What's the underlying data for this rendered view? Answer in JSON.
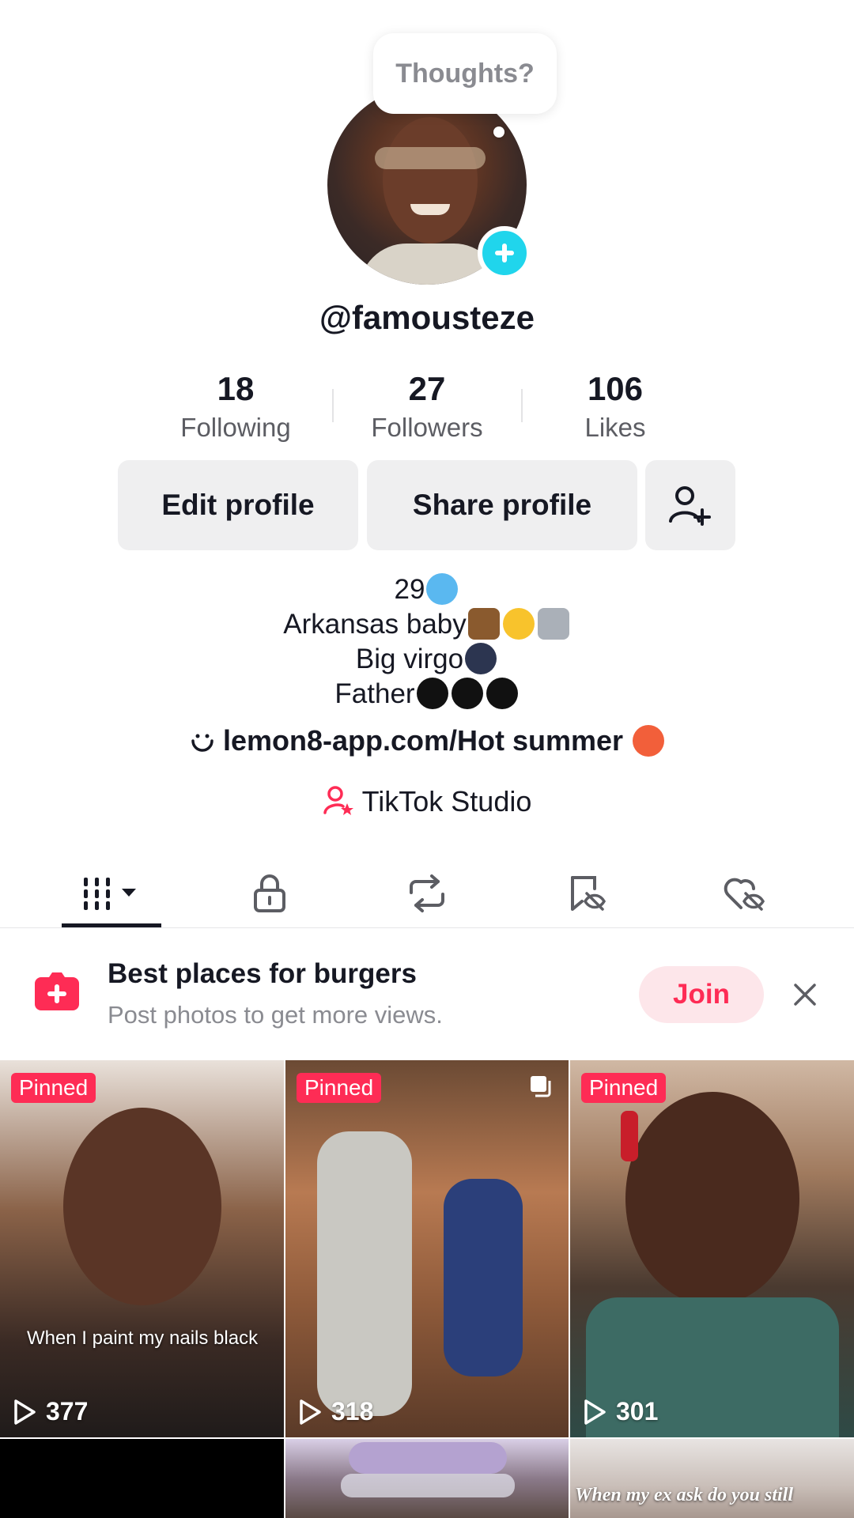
{
  "profile": {
    "bubble_text": "Thoughts?",
    "username": "@famousteze"
  },
  "stats": [
    {
      "value": "18",
      "label": "Following"
    },
    {
      "value": "27",
      "label": "Followers"
    },
    {
      "value": "106",
      "label": "Likes"
    }
  ],
  "buttons": {
    "edit": "Edit profile",
    "share": "Share profile",
    "add_friend_icon": "person-add-icon"
  },
  "bio": {
    "line1": "29",
    "line2": "Arkansas baby",
    "line3": "Big virgo",
    "line4": "Father",
    "link": "lemon8-app.com/Hot summer",
    "studio": "TikTok Studio"
  },
  "tabs": [
    {
      "icon": "videos-grid-icon",
      "active": true
    },
    {
      "icon": "lock-icon"
    },
    {
      "icon": "repost-icon"
    },
    {
      "icon": "saved-icon"
    },
    {
      "icon": "liked-icon"
    }
  ],
  "promo": {
    "title": "Best places for burgers",
    "subtitle": "Post photos to get more views.",
    "join": "Join"
  },
  "videos": [
    {
      "pinned": "Pinned",
      "views": "377",
      "caption": "When I paint my nails black"
    },
    {
      "pinned": "Pinned",
      "views": "318"
    },
    {
      "pinned": "Pinned",
      "views": "301"
    },
    {
      "caption": "When my ex ask do you still"
    }
  ],
  "colors": {
    "accent": "#fe2c55",
    "teal": "#20d5ec",
    "text": "#161823",
    "muted": "#8a8b91"
  }
}
